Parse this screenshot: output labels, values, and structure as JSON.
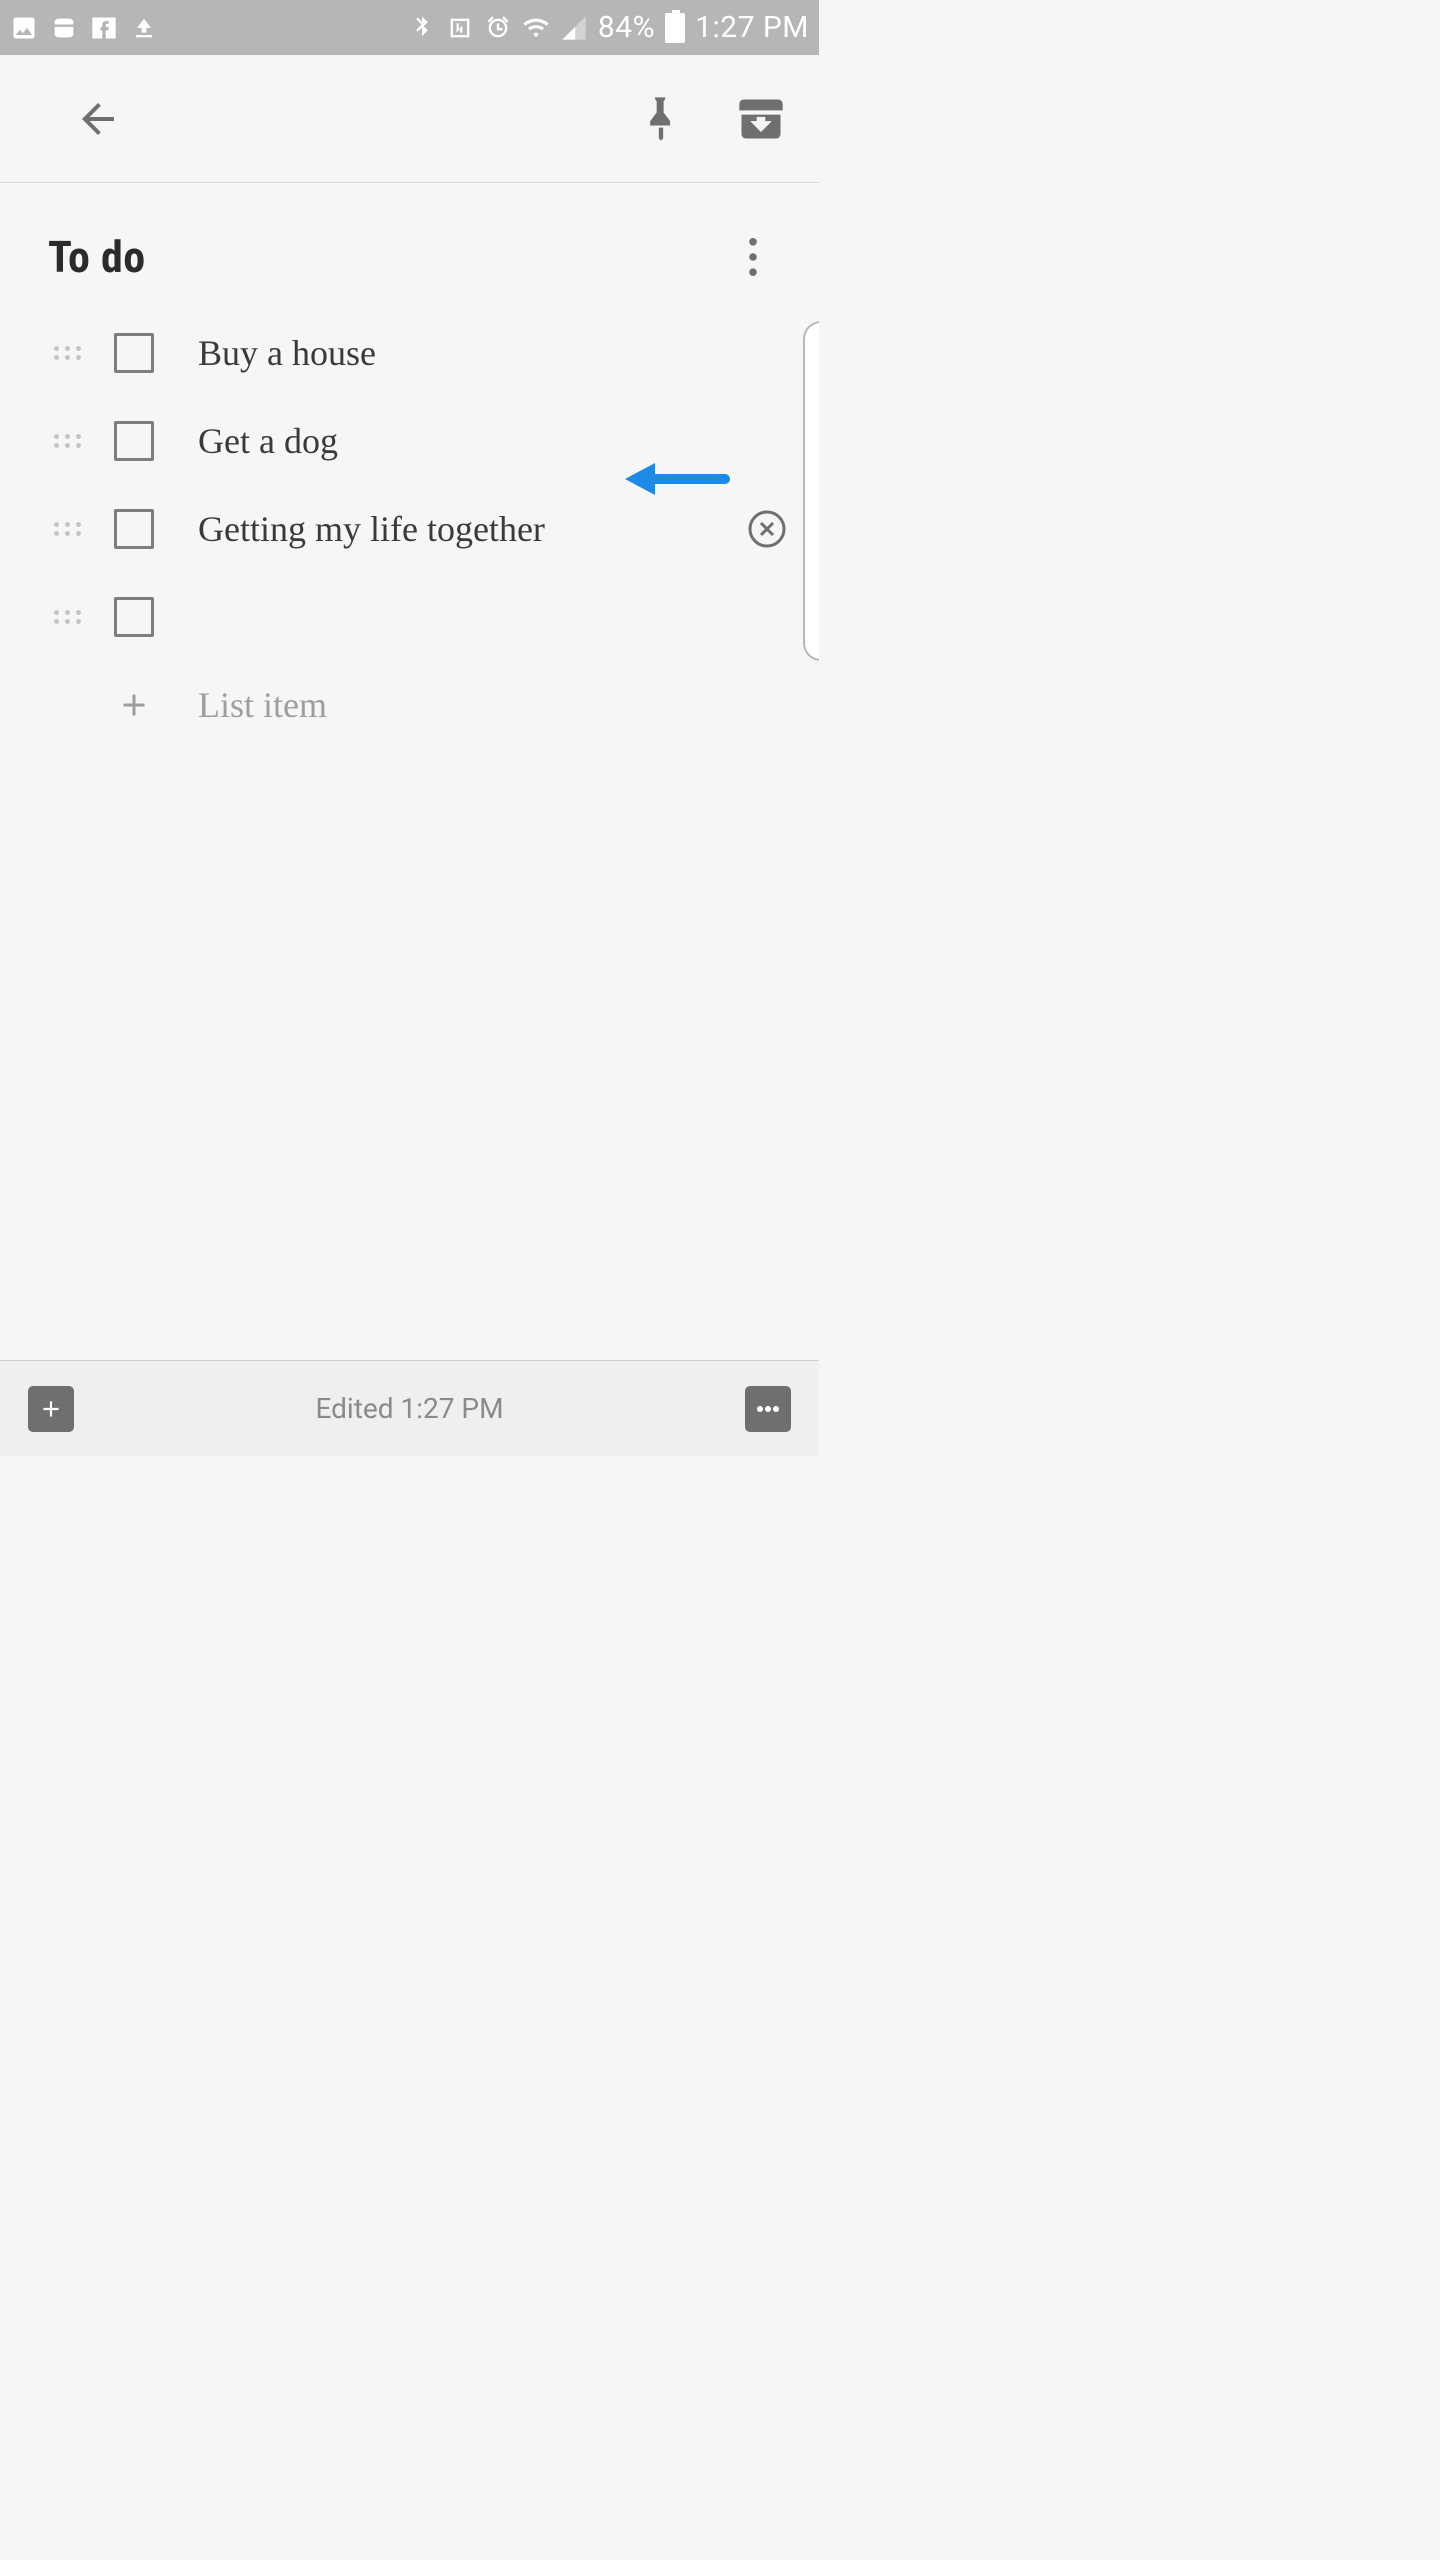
{
  "status": {
    "battery_pct": "84%",
    "time": "1:27 PM"
  },
  "note": {
    "title": "To do",
    "items": [
      {
        "text": "Buy a house",
        "checked": false
      },
      {
        "text": "Get a dog",
        "checked": false
      },
      {
        "text": "Getting my life together",
        "checked": false,
        "show_delete": true
      },
      {
        "text": "",
        "checked": false
      }
    ],
    "add_placeholder": "List item"
  },
  "footer": {
    "edited_label": "Edited 1:27 PM"
  }
}
